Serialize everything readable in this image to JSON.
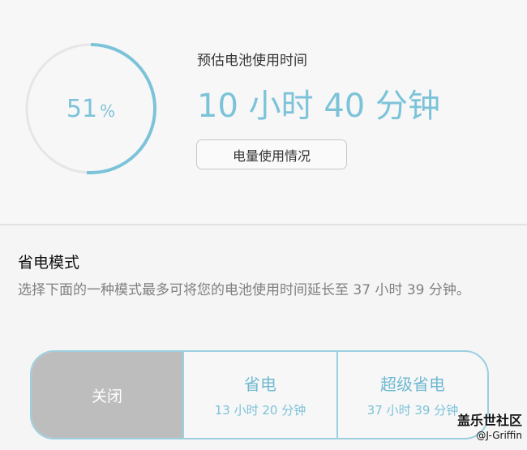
{
  "battery": {
    "level_percent": 51,
    "level_number": "51",
    "percent_sign": "%",
    "estimate_label": "预估电池使用时间",
    "estimate_value": "10 小时 40 分钟",
    "usage_button": "电量使用情况"
  },
  "colors": {
    "accent": "#7cc3d9",
    "ring_track": "#e6e6e6",
    "off_mode_bg": "#bdbdbd"
  },
  "power_saving": {
    "title": "省电模式",
    "description": "选择下面的一种模式最多可将您的电池使用时间延长至 37 小时 39 分钟。",
    "modes": [
      {
        "label": "关闭",
        "time": ""
      },
      {
        "label": "省电",
        "time": "13 小时 20 分钟"
      },
      {
        "label": "超级省电",
        "time": "37 小时 39 分钟"
      }
    ],
    "selected": "关闭"
  },
  "watermark": {
    "site": "盖乐世社区",
    "user": "@J-Griffin"
  }
}
